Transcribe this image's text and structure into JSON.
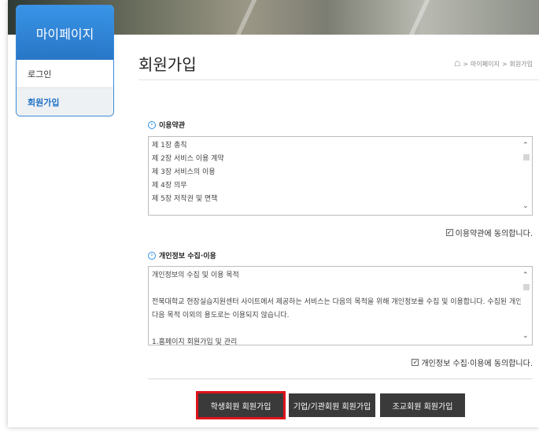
{
  "sidebar": {
    "title": "마이페이지",
    "items": [
      {
        "label": "로그인",
        "active": false
      },
      {
        "label": "회원가입",
        "active": true
      }
    ]
  },
  "header": {
    "title": "회원가입",
    "breadcrumb": [
      "마이페이지",
      "회원가입"
    ],
    "breadcrumb_sep": ">"
  },
  "terms": {
    "heading": "이용약관",
    "lines": [
      "제 1장 총칙",
      "제 2장 서비스 이용 계약",
      "제 3장 서비스의 이용",
      "제 4장 의무",
      "제 5장 저작권 및 면책"
    ],
    "agree_label": "이용약관에 동의합니다.",
    "agree_checked": true
  },
  "privacy": {
    "heading": "개인정보 수집·이용",
    "lines": [
      "개인정보의 수집 및 이용 목적",
      "",
      "전북대학교 현장실습지원센터 사이트에서 제공하는 서비스는 다음의 목적을 위해 개인정보를 수집 및 이용합니다. 수집된 개인정보는",
      "다음 목적 이외의 용도로는 이용되지 않습니다.",
      "",
      "1.홈페이지 회원가입 및 관리"
    ],
    "agree_label": "개인정보 수집·이용에 동의합니다.",
    "agree_checked": true
  },
  "buttons": {
    "student": "학생회원 회원가입",
    "company": "기업/기관회원 회원가입",
    "assistant": "조교회원 회원가입"
  },
  "colors": {
    "accent": "#1d6fc4",
    "button": "#3a3a3a",
    "highlight": "#e0121a"
  }
}
